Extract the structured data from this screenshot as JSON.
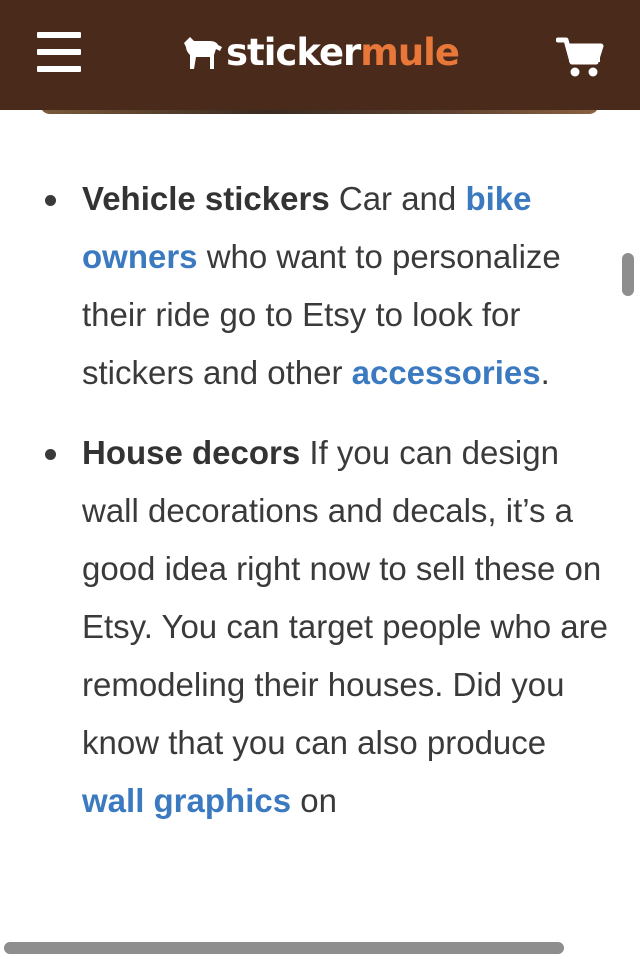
{
  "header": {
    "logo": {
      "part1": "sticker",
      "part2": "mule",
      "icon": "mule-icon"
    },
    "menu_icon": "hamburger-menu-icon",
    "cart_icon": "shopping-cart-icon",
    "colors": {
      "header_bg": "#4a2a1a",
      "logo_accent": "#e8773a",
      "link": "#3b7ac0",
      "text": "#3a3a3a"
    }
  },
  "list": {
    "items": [
      {
        "title": "Vehicle stickers",
        "text1": " Car and ",
        "link1": "bike owners",
        "text2": " who want to personalize their ride go to Etsy to look for stickers and other ",
        "link2": "accessories",
        "text3": "."
      },
      {
        "title": "House decors",
        "text1": " If you can design wall decorations and decals, it’s a good idea right now to sell these on Etsy. You can target people who are remodeling their houses. Did you know that you can also produce ",
        "link1": "wall graphics",
        "text2": " on"
      }
    ]
  }
}
